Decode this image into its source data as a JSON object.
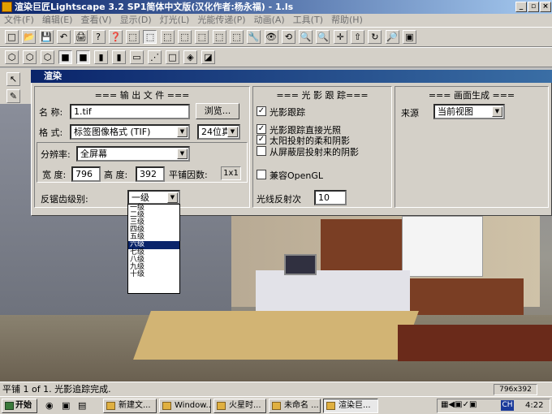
{
  "app": {
    "title": "渲染巨匠Lightscape 3.2 SP1简体中文版(汉化作者:杨永福) - 1.ls"
  },
  "menu": [
    "文件(F)",
    "编辑(E)",
    "查看(V)",
    "显示(D)",
    "灯光(L)",
    "光能传递(P)",
    "动画(A)",
    "工具(T)",
    "帮助(H)"
  ],
  "toolbar1": [
    "□",
    "📂",
    "💾",
    "↶",
    "🖨",
    "?",
    "❓",
    "⬚",
    "⬚",
    "⬚",
    "⬚",
    "⬚",
    "⬚",
    "⬚",
    "🔧",
    "👁",
    "⟲",
    "🔍",
    "🔍",
    "✛",
    "⇧",
    "↻",
    "🔎",
    "▣"
  ],
  "toolbar2": [
    "⬡",
    "⬡",
    "⬡",
    "■",
    "■",
    "▮",
    "▮",
    "▭",
    "⋰",
    "□",
    "◈",
    "◪"
  ],
  "dialog": {
    "title": "渲染",
    "output": {
      "header": "=== 输 出 文 件 ===",
      "name_label": "名 称:",
      "name_value": "1.tif",
      "browse_label": "浏览...",
      "format_label": "格 式:",
      "format_value": "标签图像格式 (TIF)",
      "bits_value": "24位真",
      "resolution_label": "分辨率:",
      "resolution_value": "全屏幕",
      "width_label": "宽 度:",
      "width_value": "796",
      "height_label": "高 度:",
      "height_value": "392",
      "tile_label": "平铺因数:",
      "tile_value": "1x1",
      "aa_label": "反锯齿级别:",
      "aa_value": "一级",
      "aa_options": [
        "一级",
        "二级",
        "三级",
        "四级",
        "五级",
        "六级",
        "七级",
        "八级",
        "九级",
        "十级"
      ],
      "aa_highlighted": "六级"
    },
    "raytrace": {
      "header": "=== 光 影 跟 踪===",
      "checks": [
        {
          "label": "光影跟踪",
          "checked": true
        },
        {
          "label": "光影跟踪直接光照",
          "checked": true
        },
        {
          "label": "太阳投射的柔和阴影",
          "checked": true
        },
        {
          "label": "从屏蔽层投射来的阴影",
          "checked": false
        },
        {
          "label": "兼容OpenGL",
          "checked": false
        }
      ],
      "reflect_label": "光线反射次",
      "reflect_value": "10"
    },
    "image": {
      "header": "=== 画面生成 ===",
      "source_label": "来源",
      "source_value": "当前视图"
    }
  },
  "status": {
    "text": "平铺 1 of 1. 光影追踪完成.",
    "size": "796x392"
  },
  "taskbar": {
    "start": "开始",
    "tasks": [
      "新建文...",
      "Window...",
      "火星时...",
      "未命名 ...",
      "渲染巨..."
    ],
    "clock": "4:22",
    "lang": "CH"
  },
  "colors": {
    "titlebar": "#0a246a",
    "face": "#d4d0c8",
    "highlight": "#0a246a"
  }
}
